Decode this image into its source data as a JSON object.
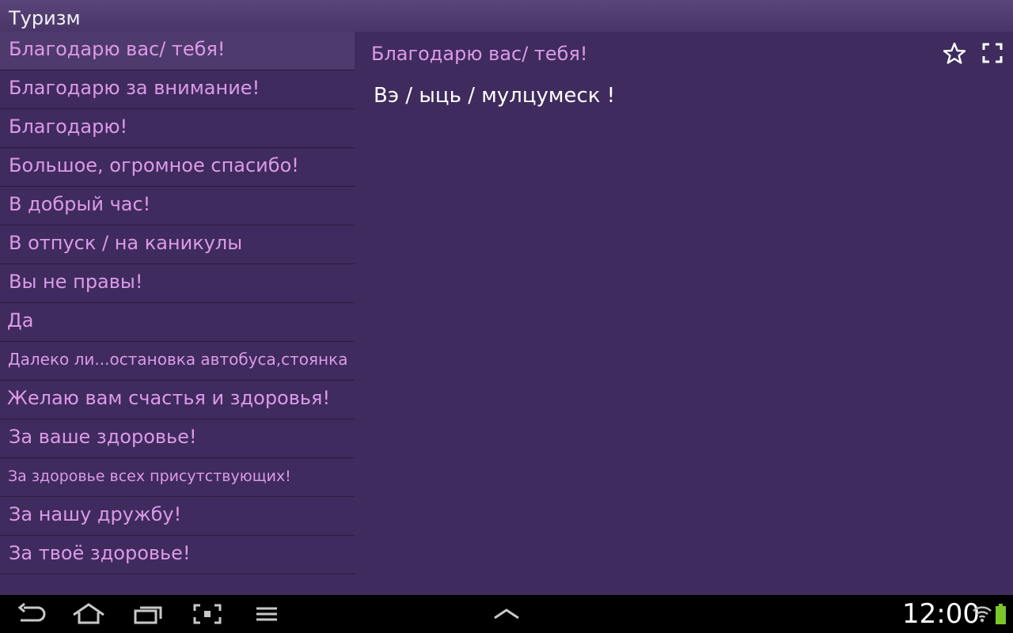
{
  "app": {
    "title": "Туризм"
  },
  "list": {
    "items": [
      {
        "label": "Благодарю вас/ тебя!"
      },
      {
        "label": "Благодарю за внимание!"
      },
      {
        "label": "Благодарю!"
      },
      {
        "label": "Большое, огромное спасибо!"
      },
      {
        "label": "В добрый час!"
      },
      {
        "label": "В отпуск / на каникулы"
      },
      {
        "label": "Вы не правы!"
      },
      {
        "label": "Да"
      },
      {
        "label": "Далеко ли...остановка автобуса,стоянка"
      },
      {
        "label": "Желаю вам счастья и здоровья!"
      },
      {
        "label": "За ваше здоровье!"
      },
      {
        "label": "За здоровье всех присутствующих!"
      },
      {
        "label": "За нашу дружбу!"
      },
      {
        "label": "За твоё здоровье!"
      }
    ],
    "selected_index": 0
  },
  "detail": {
    "title": "Благодарю вас/ тебя!",
    "translation": "Вэ / ыць / мулцумеск !"
  },
  "toolbar": {
    "icons": [
      "star-icon",
      "fullscreen-icon"
    ]
  },
  "system_bar": {
    "time": "12:00",
    "icons": [
      "back-icon",
      "home-icon",
      "recent-apps-icon",
      "screenshot-icon",
      "menu-icon",
      "up-chevron-icon",
      "wifi-icon",
      "battery-icon"
    ]
  },
  "colors": {
    "background": "#3f2b5e",
    "list_text": "#dc9ae6",
    "selected_row": "#4e3a6c",
    "translation_text": "#ffffff",
    "battery": "#7cc52b"
  }
}
